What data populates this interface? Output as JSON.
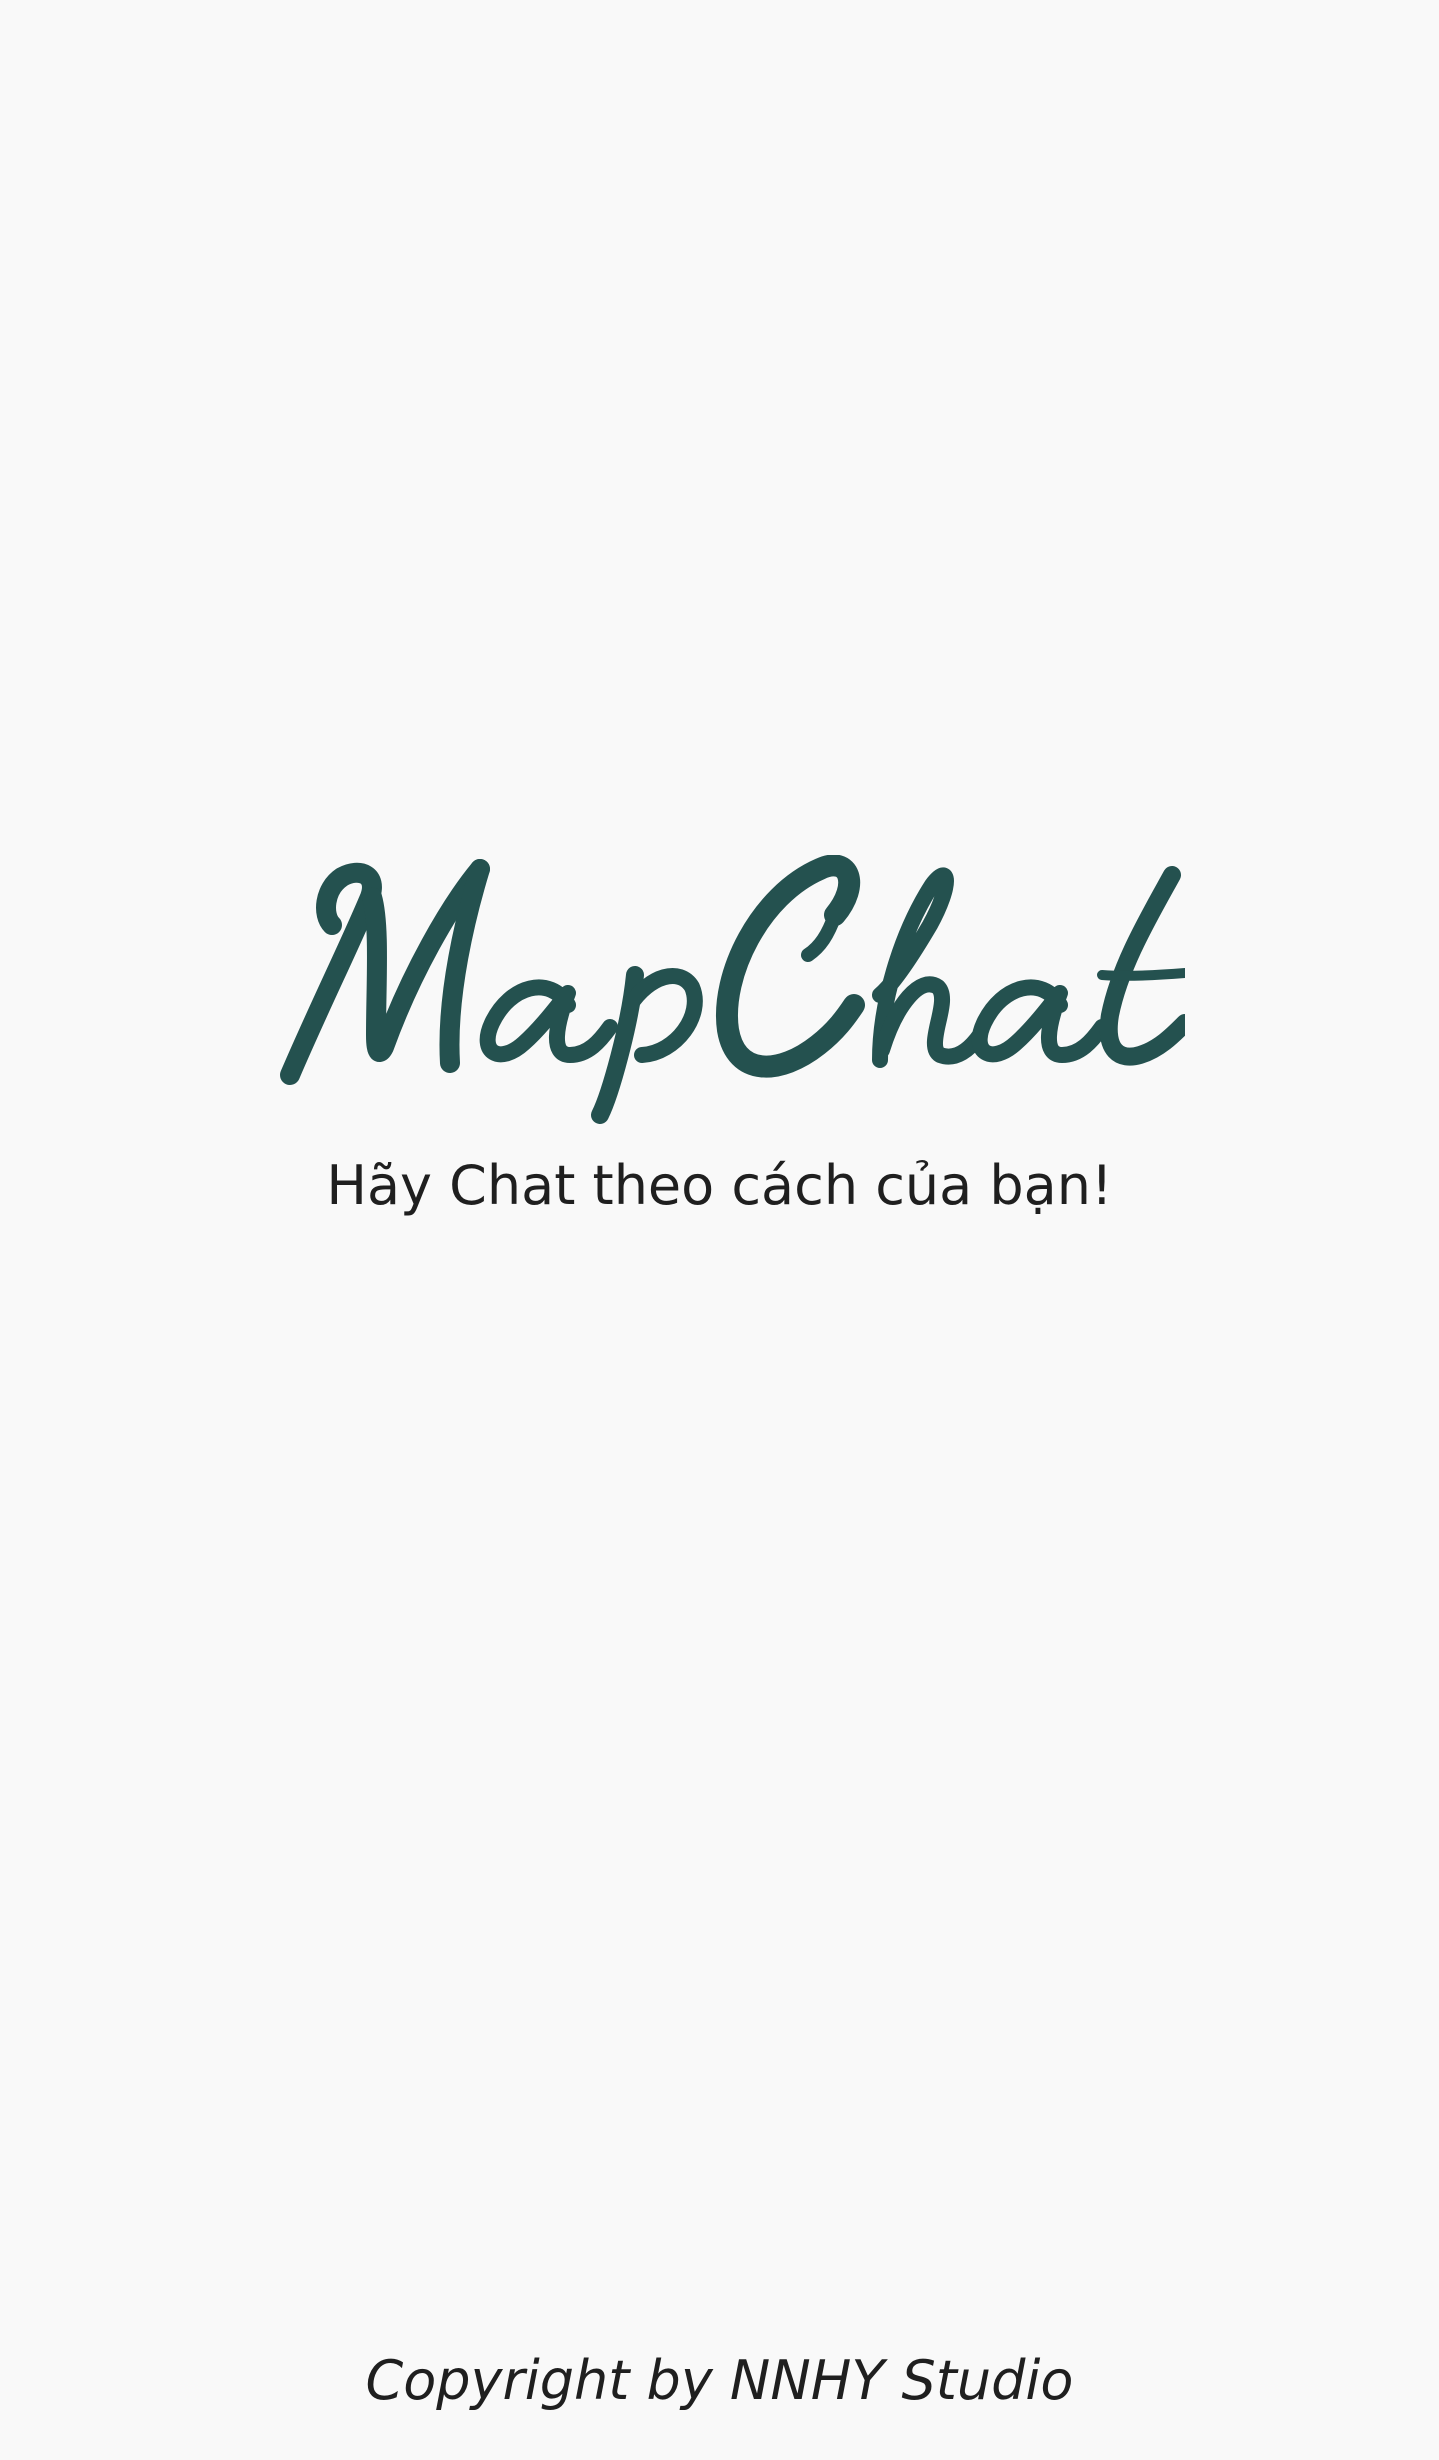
{
  "app": {
    "logo_text": "MapChat",
    "tagline": "Hãy Chat theo cách của bạn!",
    "copyright": "Copyright by NNHY Studio"
  },
  "colors": {
    "background": "#f9f9f9",
    "brand": "#24514f",
    "text": "#1f1f1f"
  }
}
